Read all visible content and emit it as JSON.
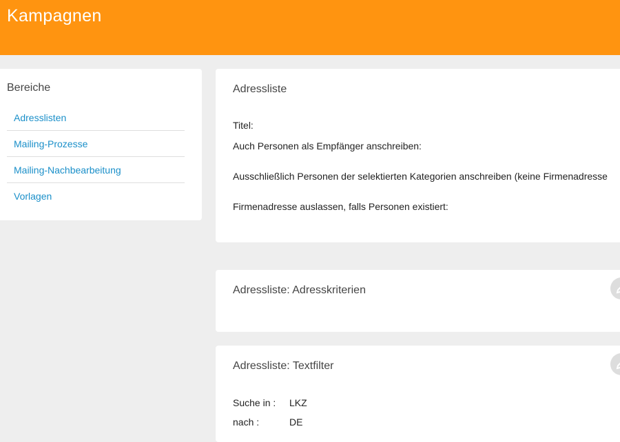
{
  "header": {
    "title": "Kampagnen"
  },
  "sidebar": {
    "heading": "Bereiche",
    "items": [
      {
        "label": "Adresslisten"
      },
      {
        "label": "Mailing-Prozesse"
      },
      {
        "label": "Mailing-Nachbearbeitung"
      },
      {
        "label": "Vorlagen"
      }
    ]
  },
  "card_address_list": {
    "title": "Adressliste",
    "rows": [
      "Titel:",
      "Auch Personen als Empfänger anschreiben:",
      "Ausschließlich Personen der selektierten Kategorien anschreiben (keine Firmenadresse",
      "Firmenadresse auslassen, falls Personen existiert:"
    ]
  },
  "card_criteria": {
    "title": "Adressliste: Adresskriterien",
    "edit_icon": "pencil-icon"
  },
  "card_textfilter": {
    "title": "Adressliste: Textfilter",
    "edit_icon": "pencil-icon",
    "fields": [
      {
        "label": "Suche in :",
        "value": "LKZ"
      },
      {
        "label": "nach :",
        "value": "DE"
      }
    ]
  },
  "colors": {
    "header_bg": "#ff9410",
    "link": "#1a8fc9",
    "page_bg": "#eeeeee"
  }
}
